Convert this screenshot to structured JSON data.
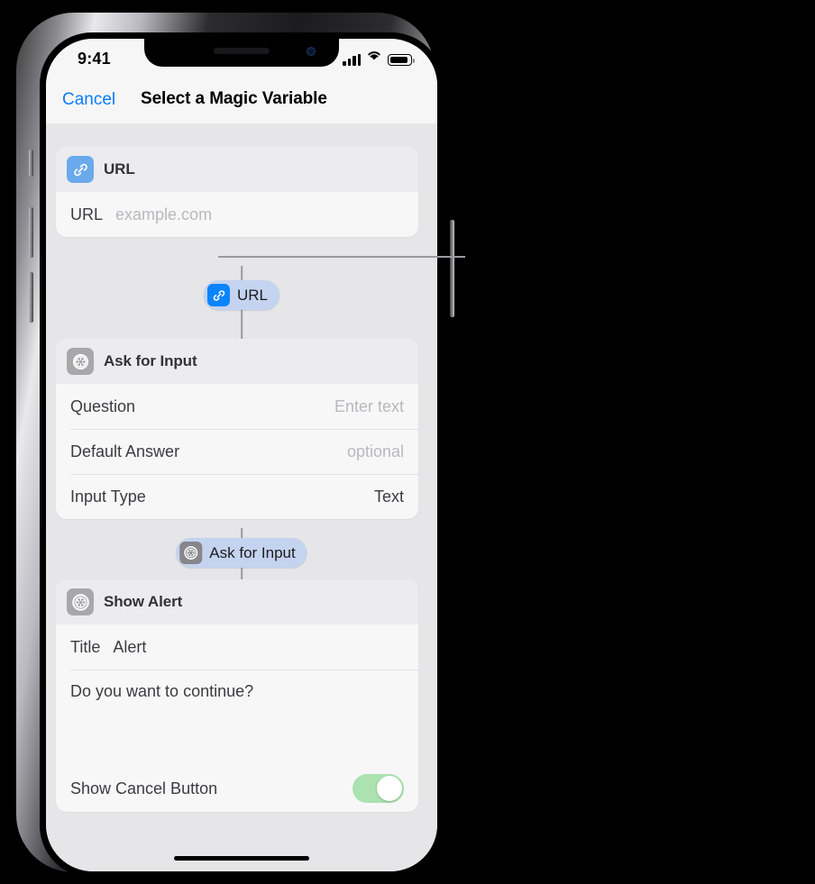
{
  "status_bar": {
    "time": "9:41",
    "icons": [
      "cellular-signal-icon",
      "wifi-icon",
      "battery-icon"
    ]
  },
  "nav_bar": {
    "cancel_label": "Cancel",
    "title": "Select a Magic Variable"
  },
  "cards": [
    {
      "id": "url-action",
      "icon": "link-icon",
      "icon_color": "#6aa9ec",
      "header_title": "URL",
      "rows": [
        {
          "type": "inline",
          "label": "URL",
          "value": "example.com",
          "placeholder": true
        }
      ]
    },
    {
      "id": "ask-for-input-action",
      "icon": "gear-icon",
      "icon_color": "#a8a8ac",
      "header_title": "Ask for Input",
      "rows": [
        {
          "type": "right",
          "label": "Question",
          "value": "Enter text",
          "placeholder": true
        },
        {
          "type": "right",
          "label": "Default Answer",
          "value": "optional",
          "placeholder": true
        },
        {
          "type": "right",
          "label": "Input Type",
          "value": "Text",
          "placeholder": false
        }
      ]
    },
    {
      "id": "show-alert-action",
      "icon": "gear-icon",
      "icon_color": "#a8a8ac",
      "header_title": "Show Alert",
      "rows": [
        {
          "type": "inline",
          "label": "Title",
          "value": "Alert",
          "placeholder": false
        },
        {
          "type": "textarea",
          "value": "Do you want to continue?"
        },
        {
          "type": "toggle",
          "label": "Show Cancel Button",
          "value": "on"
        }
      ]
    }
  ],
  "magic_variables": [
    {
      "id": "url-token",
      "icon": "link-icon",
      "icon_color": "#0a84ff",
      "label": "URL"
    },
    {
      "id": "ask-for-input-token",
      "icon": "gear-icon",
      "icon_color": "#86868b",
      "label": "Ask for Input"
    }
  ],
  "colors": {
    "accent_blue": "#0a7cff",
    "token_pill": "#c4d3ef",
    "toggle_on": "#abe2b0",
    "screen_bg": "#e6e6e9",
    "card_bg": "#f7f7f8",
    "card_header_bg": "#ececee",
    "connector": "#9a9a9f"
  },
  "callout": {
    "target": "url-token",
    "name": "magic-variable-callout-line"
  }
}
